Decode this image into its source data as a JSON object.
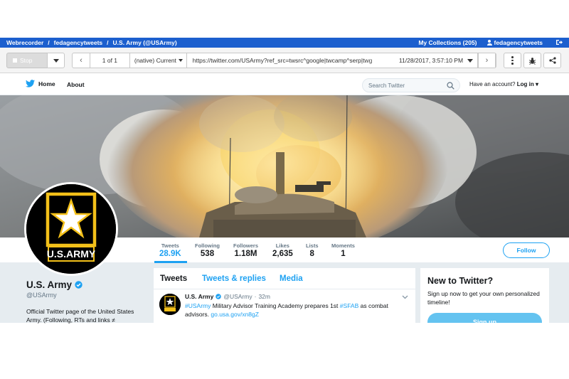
{
  "webrecorder_bar": {
    "brand": "Webrecorder",
    "crumb_collection": "fedagencytweets",
    "crumb_page": "U.S. Army (@USArmy)",
    "my_collections": "My Collections (205)",
    "username": "fedagencytweets",
    "colors": {
      "bar": "#1c5fce"
    }
  },
  "toolbar": {
    "stop_label": "Stop",
    "page_count": "1 of 1",
    "mode": "(native) Current",
    "url": "https://twitter.com/USArmy?ref_src=twsrc^google|twcamp^serp|twg",
    "timestamp": "11/28/2017, 3:57:10 PM",
    "icons": [
      "back-arrow-icon",
      "forward-arrow-icon",
      "more-vertical-icon",
      "bug-icon",
      "share-icon",
      "logout-icon"
    ]
  },
  "twitter_nav": {
    "home_label": "Home",
    "about_label": "About",
    "search_placeholder": "Search Twitter",
    "have_account": "Have an account?",
    "login_label": "Log in"
  },
  "profile_stats": [
    {
      "label": "Tweets",
      "value": "28.9K"
    },
    {
      "label": "Following",
      "value": "538"
    },
    {
      "label": "Followers",
      "value": "1.18M"
    },
    {
      "label": "Likes",
      "value": "2,635"
    },
    {
      "label": "Lists",
      "value": "8"
    },
    {
      "label": "Moments",
      "value": "1"
    }
  ],
  "follow_label": "Follow",
  "avatar_logo_text": "U.S.ARMY",
  "profile": {
    "name": "U.S. Army",
    "handle": "@USArmy",
    "bio": "Official Twitter page of the United States Army. (Following, RTs and links ≠"
  },
  "timeline": {
    "tabs": [
      "Tweets",
      "Tweets & replies",
      "Media"
    ],
    "tweet": {
      "name": "U.S. Army",
      "handle": "@USArmy",
      "separator": "·",
      "time": "32m",
      "tag1": "#USArmy",
      "text1": " Military Advisor Training Academy prepares 1st ",
      "tag2": "#SFAB",
      "text2": " as combat advisors. ",
      "link": "go.usa.gov/xn8gZ"
    }
  },
  "signup": {
    "title": "New to Twitter?",
    "description": "Sign up now to get your own personalized timeline!",
    "button_label": "Sign up"
  },
  "colors": {
    "twitter_blue": "#1da1f2",
    "army_gold": "#f3c019",
    "page_bg": "#e6ecf0"
  }
}
